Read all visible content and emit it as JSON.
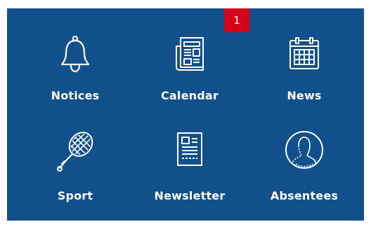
{
  "badge": {
    "count": "1"
  },
  "tiles": [
    {
      "label": "Notices",
      "icon": "bell-icon"
    },
    {
      "label": "Calendar",
      "icon": "newspaper-icon"
    },
    {
      "label": "News",
      "icon": "calendar-icon"
    },
    {
      "label": "Sport",
      "icon": "tennis-racket-icon"
    },
    {
      "label": "Newsletter",
      "icon": "document-icon"
    },
    {
      "label": "Absentees",
      "icon": "person-circle-icon"
    }
  ],
  "colors": {
    "panel": "#12508b",
    "badge": "#d50019",
    "text": "#ffffff"
  }
}
